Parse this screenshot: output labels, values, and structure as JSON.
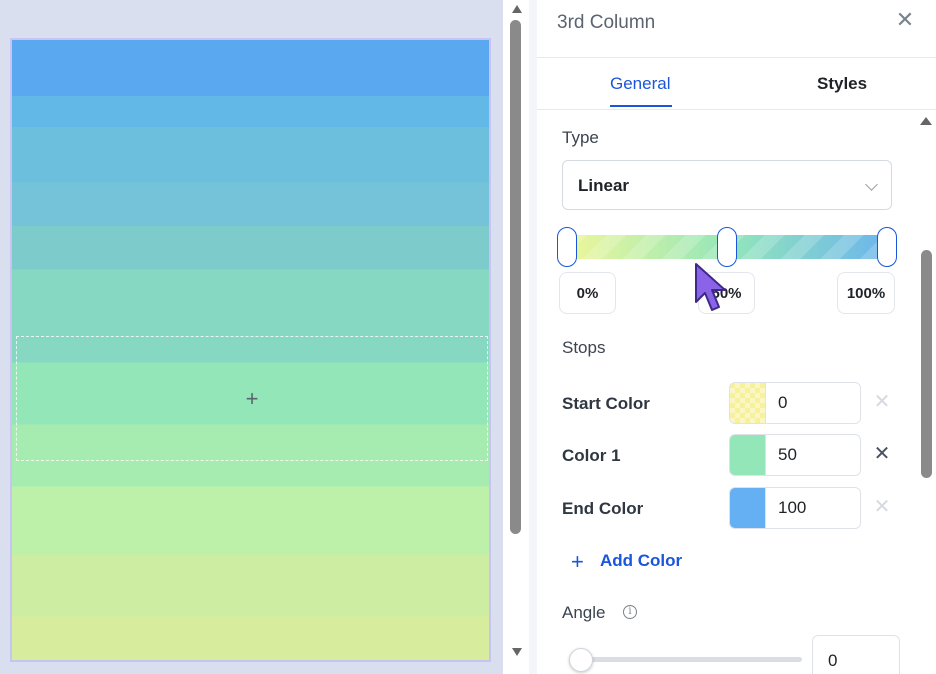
{
  "canvas": {
    "drop_zone_icon": "plus-icon",
    "drop_zone_symbol": "+"
  },
  "panel": {
    "title": "3rd Column",
    "close_symbol": "✕",
    "tabs": [
      {
        "label": "General",
        "active": true
      },
      {
        "label": "Styles",
        "active": false
      }
    ]
  },
  "gradient": {
    "type_label": "Type",
    "type_value": "Linear",
    "bar_colors": [
      "#eef79a",
      "#93e6ba",
      "#6ab4ee"
    ],
    "stop_chips": [
      "0%",
      "50%",
      "100%"
    ],
    "stops_label": "Stops",
    "stops": [
      {
        "label": "Start Color",
        "value": "0",
        "color": "#f6f19a",
        "removable": false
      },
      {
        "label": "Color 1",
        "value": "50",
        "color": "#92e6b8",
        "removable": true
      },
      {
        "label": "End Color",
        "value": "100",
        "color": "#65b0f2",
        "removable": false
      }
    ],
    "remove_symbol": "✕",
    "add_color_label": "Add Color",
    "add_symbol": "+",
    "angle_label": "Angle",
    "angle_info_symbol": "i",
    "angle_value": "0"
  },
  "colors": {
    "accent": "#1a56db"
  }
}
